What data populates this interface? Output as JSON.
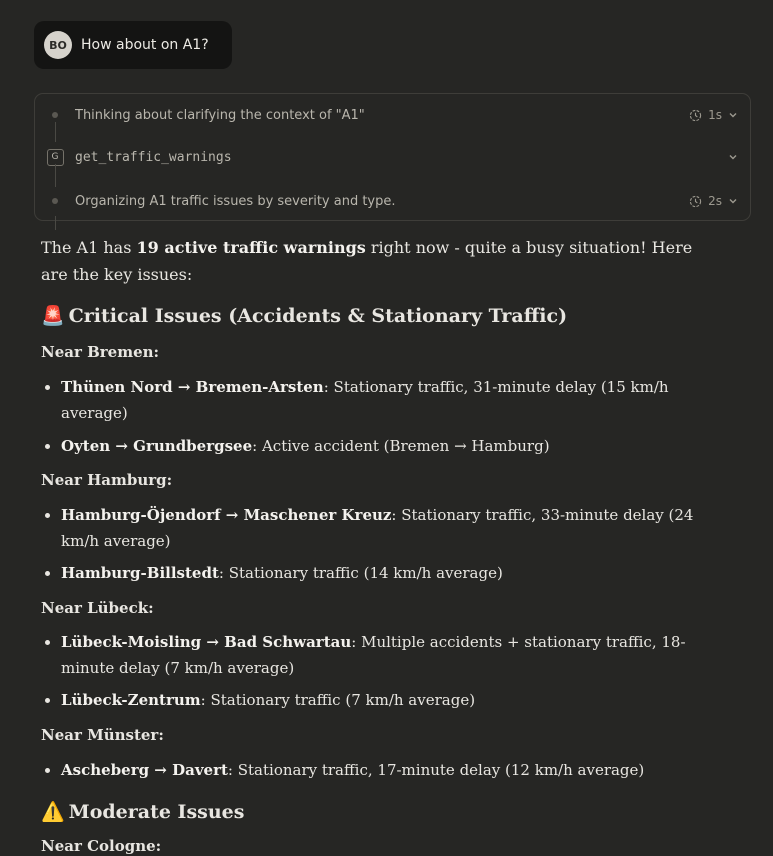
{
  "user_message": {
    "initials": "BO",
    "text": "How about on A1?"
  },
  "tool_steps": [
    {
      "label": "Thinking about clarifying the context of \"A1\"",
      "duration": "1s",
      "icon": "clock-icon"
    },
    {
      "badge": "G",
      "label": "get_traffic_warnings"
    },
    {
      "label": "Organizing A1 traffic issues by severity and type.",
      "duration": "2s",
      "icon": "clock-icon"
    }
  ],
  "response": {
    "intro_prefix": "The A1 has ",
    "intro_bold": "19 active traffic warnings",
    "intro_suffix": " right now - quite a busy situation! Here are the key issues:",
    "critical_emoji": "🚨",
    "critical_heading": "Critical Issues (Accidents & Stationary Traffic)",
    "groups": [
      {
        "title": "Near Bremen:",
        "items": [
          {
            "route": "Thünen Nord → Bremen-Arsten",
            "detail": ": Stationary traffic, 31-minute delay (15 km/h average)"
          },
          {
            "route": "Oyten → Grundbergsee",
            "detail": ": Active accident (Bremen → Hamburg)"
          }
        ]
      },
      {
        "title": "Near Hamburg:",
        "items": [
          {
            "route": "Hamburg-Öjendorf → Maschener Kreuz",
            "detail": ": Stationary traffic, 33-minute delay (24 km/h average)"
          },
          {
            "route": "Hamburg-Billstedt",
            "detail": ": Stationary traffic (14 km/h average)"
          }
        ]
      },
      {
        "title": "Near Lübeck:",
        "items": [
          {
            "route": "Lübeck-Moisling → Bad Schwartau",
            "detail": ": Multiple accidents + stationary traffic, 18-minute delay (7 km/h average)"
          },
          {
            "route": "Lübeck-Zentrum",
            "detail": ": Stationary traffic (7 km/h average)"
          }
        ]
      },
      {
        "title": "Near Münster:",
        "items": [
          {
            "route": "Ascheberg → Davert",
            "detail": ": Stationary traffic, 17-minute delay (12 km/h average)"
          }
        ]
      }
    ],
    "moderate_emoji": "⚠️",
    "moderate_heading": "Moderate Issues",
    "next_group": "Near Cologne:"
  }
}
